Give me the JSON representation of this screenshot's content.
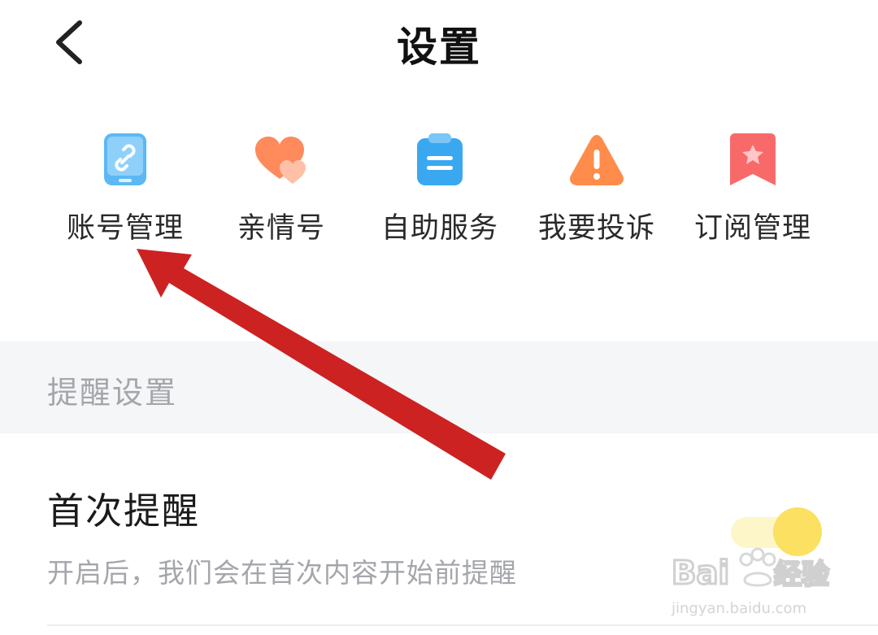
{
  "header": {
    "title": "设置",
    "back_icon": "chevron-left-icon"
  },
  "shortcuts": [
    {
      "label": "账号管理",
      "icon": "account-tablet-icon",
      "color": "#5bb8f5"
    },
    {
      "label": "亲情号",
      "icon": "hearts-icon",
      "color": "#ff8a5c"
    },
    {
      "label": "自助服务",
      "icon": "clipboard-icon",
      "color": "#3aa8f0"
    },
    {
      "label": "我要投诉",
      "icon": "warning-triangle-icon",
      "color": "#ff8c4a"
    },
    {
      "label": "订阅管理",
      "icon": "bookmark-star-icon",
      "color": "#f86a6a"
    }
  ],
  "reminder_section": {
    "title": "提醒设置",
    "items": [
      {
        "title": "首次提醒",
        "description": "开启后，我们会在首次内容开始前提醒",
        "enabled": true,
        "toggle_color": "#fce062"
      }
    ]
  },
  "annotation": {
    "type": "arrow",
    "color": "#cc2222",
    "points_to": "账号管理"
  },
  "watermark": {
    "text": "Baidu经验",
    "url_text": "jingyan.baidu.com"
  }
}
